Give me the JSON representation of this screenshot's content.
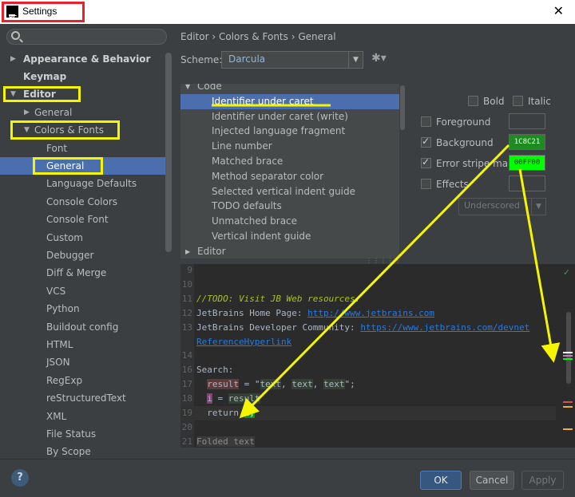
{
  "window": {
    "title": "Settings",
    "app_icon": "PC",
    "close_glyph": "✕"
  },
  "sidebar": {
    "search_placeholder": "",
    "items": [
      {
        "label": "Appearance & Behavior",
        "arrow": "▶",
        "bold": true
      },
      {
        "label": "Keymap",
        "bold": true
      },
      {
        "label": "Editor",
        "arrow": "▼",
        "bold": true
      },
      {
        "label": "General",
        "arrow": "▶"
      },
      {
        "label": "Colors & Fonts",
        "arrow": "▼"
      },
      {
        "label": "Font"
      },
      {
        "label": "General",
        "selected": true
      },
      {
        "label": "Language Defaults"
      },
      {
        "label": "Console Colors"
      },
      {
        "label": "Console Font"
      },
      {
        "label": "Custom"
      },
      {
        "label": "Debugger"
      },
      {
        "label": "Diff & Merge"
      },
      {
        "label": "VCS"
      },
      {
        "label": "Python"
      },
      {
        "label": "Buildout config"
      },
      {
        "label": "HTML"
      },
      {
        "label": "JSON"
      },
      {
        "label": "RegExp"
      },
      {
        "label": "reStructuredText"
      },
      {
        "label": "XML"
      },
      {
        "label": "File Status"
      },
      {
        "label": "By Scope"
      }
    ]
  },
  "main": {
    "breadcrumb": "Editor › Colors & Fonts › General",
    "scheme_label": "Scheme:",
    "scheme_value": "Darcula",
    "list": [
      {
        "label": "Code",
        "arrow": "▼",
        "top": true
      },
      {
        "label": "Identifier under caret",
        "selected": true
      },
      {
        "label": "Identifier under caret (write)"
      },
      {
        "label": "Injected language fragment"
      },
      {
        "label": "Line number"
      },
      {
        "label": "Matched brace"
      },
      {
        "label": "Method separator color"
      },
      {
        "label": "Selected vertical indent guide"
      },
      {
        "label": "TODO defaults"
      },
      {
        "label": "Unmatched brace"
      },
      {
        "label": "Vertical indent guide"
      },
      {
        "label": "Editor",
        "arrow": "▶",
        "top": true
      }
    ],
    "options": {
      "bold_label": "Bold",
      "italic_label": "Italic",
      "foreground_label": "Foreground",
      "background_label": "Background",
      "background_value": "1C8C21",
      "error_stripe_label": "Error stripe mark",
      "error_stripe_value": "00FF00",
      "effects_label": "Effects",
      "effects_combo": "Underscored"
    },
    "editor": {
      "lines": [
        {
          "n": "9",
          "parts": []
        },
        {
          "n": "10",
          "parts": []
        },
        {
          "n": "11",
          "parts": [
            {
              "t": "//TODO: Visit JB Web resources:",
              "c": "todo"
            }
          ]
        },
        {
          "n": "12",
          "parts": [
            {
              "t": "JetBrains Home Page: "
            },
            {
              "t": "http://www.jetbrains.com",
              "c": "link"
            }
          ]
        },
        {
          "n": "13",
          "parts": [
            {
              "t": "JetBrains Developer Community: "
            },
            {
              "t": "https://www.jetbrains.com/devnet",
              "c": "link"
            }
          ]
        },
        {
          "n": "",
          "parts": [
            {
              "t": "ReferenceHyperlink",
              "c": "link"
            }
          ]
        },
        {
          "n": "14",
          "parts": []
        },
        {
          "n": "16",
          "parts": [
            {
              "t": "Search:"
            }
          ]
        },
        {
          "n": "17",
          "parts": [
            {
              "t": "  "
            },
            {
              "t": "result",
              "c": "unused"
            },
            {
              "t": " = \""
            },
            {
              "t": "text",
              "c": "caret-hl"
            },
            {
              "t": ", "
            },
            {
              "t": "text",
              "c": "caret-hl"
            },
            {
              "t": ", "
            },
            {
              "t": "text",
              "c": "caret-hl"
            },
            {
              "t": "\";"
            }
          ]
        },
        {
          "n": "18",
          "parts": [
            {
              "t": "  "
            },
            {
              "t": "i",
              "c": "write"
            },
            {
              "t": " = "
            },
            {
              "t": "result",
              "c": "caret-hl"
            }
          ]
        },
        {
          "n": "19",
          "parts": [
            {
              "t": "  return "
            },
            {
              "t": "i;",
              "c": "id-caret"
            }
          ],
          "current": true
        },
        {
          "n": "20",
          "parts": []
        },
        {
          "n": "21",
          "parts": [
            {
              "t": "Folded text",
              "c": "folded"
            }
          ]
        }
      ],
      "ok_glyph": "✓"
    }
  },
  "footer": {
    "help_label": "?",
    "ok_label": "OK",
    "cancel_label": "Cancel",
    "apply_label": "Apply"
  },
  "colors": {
    "selection": "#4b6eaf",
    "annotation_yellow": "#f5f500",
    "annotation_red": "#e8212e",
    "swatch_background": "#1C8C21",
    "swatch_error_stripe": "#00FF00"
  }
}
